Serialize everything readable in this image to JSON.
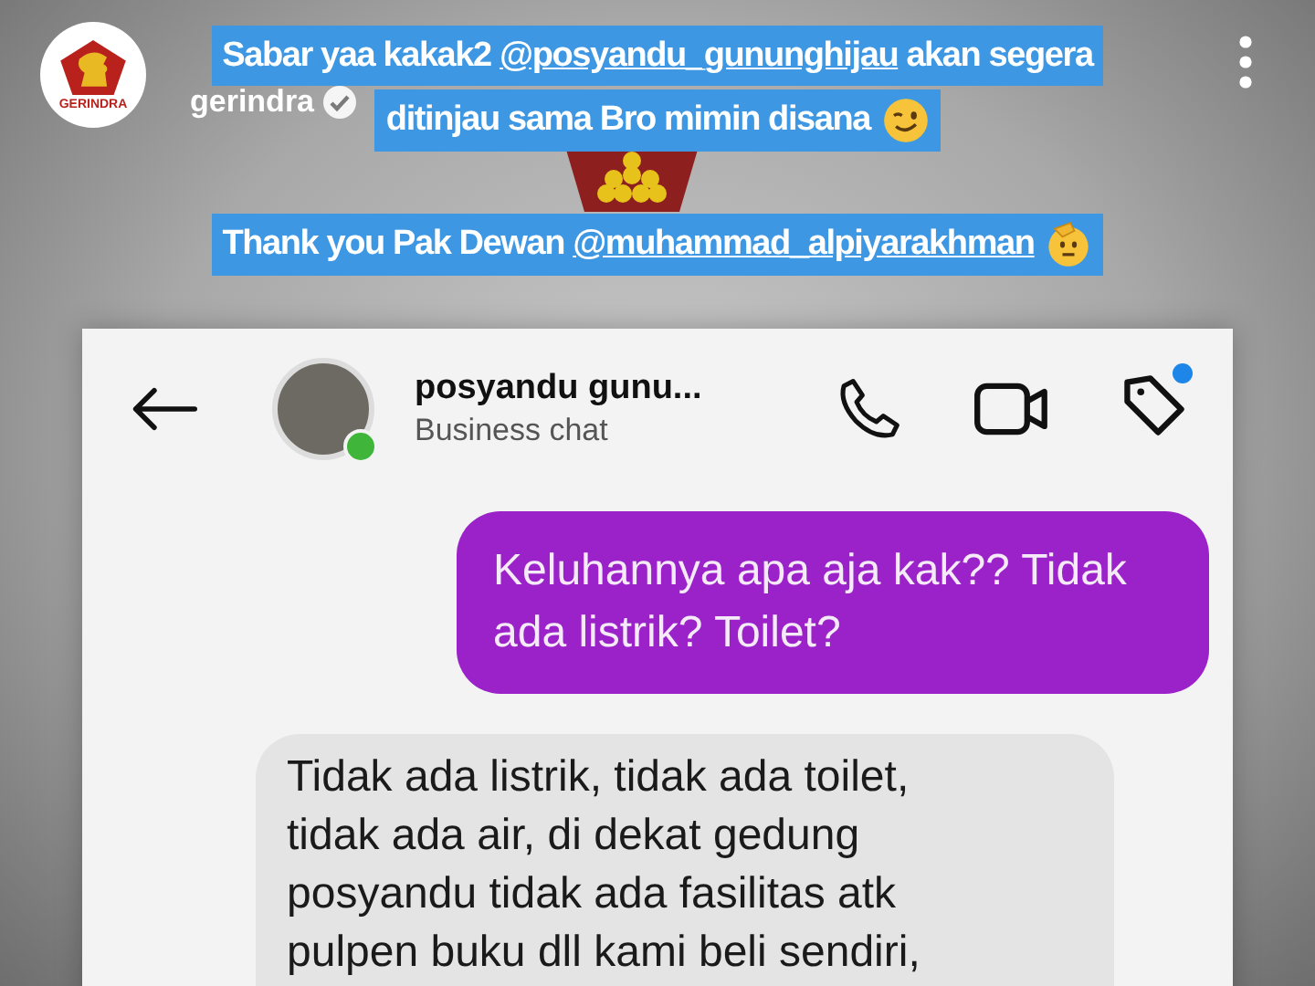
{
  "story": {
    "username": "gerindra",
    "verified": true,
    "logo_text": "GERINDRA"
  },
  "caption_blocks": [
    {
      "lines": [
        {
          "parts": [
            {
              "kind": "plain",
              "text": "Sabar yaa kakak2 "
            },
            {
              "kind": "mention",
              "text": "@posyandu_gununghijau"
            },
            {
              "kind": "plain",
              "text": " akan segera"
            }
          ]
        },
        {
          "parts": [
            {
              "kind": "plain",
              "text": "ditinjau sama Bro mimin disana"
            }
          ],
          "emoji": true
        }
      ]
    },
    {
      "lines": [
        {
          "parts": [
            {
              "kind": "plain",
              "text": "Thank you Pak Dewan "
            },
            {
              "kind": "mention",
              "text": "@muhammad_alpiyarakhman"
            }
          ],
          "emoji": true
        }
      ]
    }
  ],
  "chat": {
    "name": "posyandu gunu...",
    "subtitle": "Business chat",
    "online": true,
    "tag_badge": true,
    "messages": [
      {
        "kind": "sent",
        "text": "Keluhannya apa aja kak?? Tidak ada listrik? Toilet?"
      },
      {
        "kind": "received",
        "text": "Tidak ada listrik, tidak ada toilet, tidak ada air, di dekat gedung posyandu tidak ada fasilitas atk pulpen buku dll kami beli sendiri,"
      }
    ]
  }
}
